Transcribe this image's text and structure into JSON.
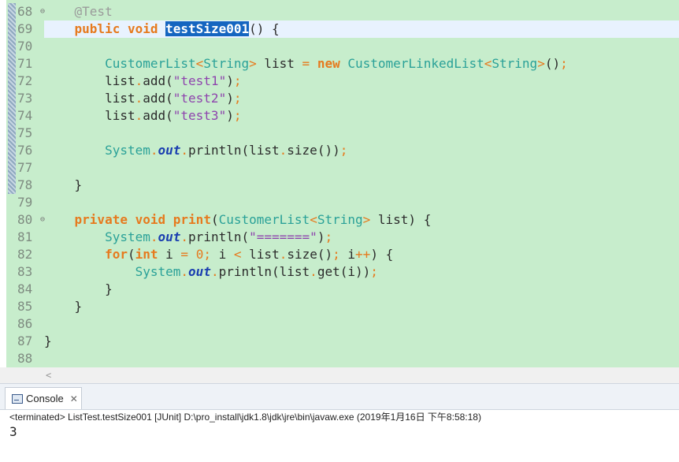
{
  "editor": {
    "colors": {
      "background": "#c7edcc",
      "current_line": "#e8f2fe",
      "selection": "#1565c0"
    },
    "lines": [
      {
        "num": "68",
        "fold": "⊖",
        "tokens": [
          [
            "ann",
            "    @Test"
          ]
        ]
      },
      {
        "num": "69",
        "tokens": [
          [
            "",
            "    "
          ],
          [
            "kw",
            "public"
          ],
          [
            "",
            " "
          ],
          [
            "kw",
            "void"
          ],
          [
            "",
            " "
          ],
          [
            "sel",
            "testSize001"
          ],
          [
            "",
            "() {"
          ]
        ]
      },
      {
        "num": "70",
        "tokens": []
      },
      {
        "num": "71",
        "tokens": [
          [
            "",
            "        "
          ],
          [
            "ty",
            "CustomerList"
          ],
          [
            "pu",
            "<"
          ],
          [
            "ty",
            "String"
          ],
          [
            "pu",
            ">"
          ],
          [
            "",
            " list "
          ],
          [
            "pu",
            "="
          ],
          [
            "",
            " "
          ],
          [
            "kw",
            "new"
          ],
          [
            "",
            " "
          ],
          [
            "ty",
            "CustomerLinkedList"
          ],
          [
            "pu",
            "<"
          ],
          [
            "ty",
            "String"
          ],
          [
            "pu",
            ">"
          ],
          [
            "",
            "()"
          ],
          [
            "pu",
            ";"
          ]
        ]
      },
      {
        "num": "72",
        "tokens": [
          [
            "",
            "        list"
          ],
          [
            "pu",
            "."
          ],
          [
            "",
            "add("
          ],
          [
            "str",
            "\"test1\""
          ],
          [
            "",
            ")"
          ],
          [
            "pu",
            ";"
          ]
        ]
      },
      {
        "num": "73",
        "tokens": [
          [
            "",
            "        list"
          ],
          [
            "pu",
            "."
          ],
          [
            "",
            "add("
          ],
          [
            "str",
            "\"test2\""
          ],
          [
            "",
            ")"
          ],
          [
            "pu",
            ";"
          ]
        ]
      },
      {
        "num": "74",
        "tokens": [
          [
            "",
            "        list"
          ],
          [
            "pu",
            "."
          ],
          [
            "",
            "add("
          ],
          [
            "str",
            "\"test3\""
          ],
          [
            "",
            ")"
          ],
          [
            "pu",
            ";"
          ]
        ]
      },
      {
        "num": "75",
        "tokens": []
      },
      {
        "num": "76",
        "tokens": [
          [
            "",
            "        "
          ],
          [
            "ty",
            "System"
          ],
          [
            "pu",
            "."
          ],
          [
            "st",
            "out"
          ],
          [
            "pu",
            "."
          ],
          [
            "",
            "println(list"
          ],
          [
            "pu",
            "."
          ],
          [
            "",
            "size())"
          ],
          [
            "pu",
            ";"
          ]
        ]
      },
      {
        "num": "77",
        "tokens": []
      },
      {
        "num": "78",
        "tokens": [
          [
            "",
            "    }"
          ]
        ]
      },
      {
        "num": "79",
        "tokens": []
      },
      {
        "num": "80",
        "fold": "⊖",
        "tokens": [
          [
            "",
            "    "
          ],
          [
            "kw",
            "private"
          ],
          [
            "",
            " "
          ],
          [
            "kw",
            "void"
          ],
          [
            "",
            " "
          ],
          [
            "kw",
            "print"
          ],
          [
            "",
            "("
          ],
          [
            "ty",
            "CustomerList"
          ],
          [
            "pu",
            "<"
          ],
          [
            "ty",
            "String"
          ],
          [
            "pu",
            ">"
          ],
          [
            "",
            " list) {"
          ]
        ]
      },
      {
        "num": "81",
        "tokens": [
          [
            "",
            "        "
          ],
          [
            "ty",
            "System"
          ],
          [
            "pu",
            "."
          ],
          [
            "st",
            "out"
          ],
          [
            "pu",
            "."
          ],
          [
            "",
            "println("
          ],
          [
            "str",
            "\"=======\""
          ],
          [
            "",
            ")"
          ],
          [
            "pu",
            ";"
          ]
        ]
      },
      {
        "num": "82",
        "tokens": [
          [
            "",
            "        "
          ],
          [
            "kw",
            "for"
          ],
          [
            "",
            "("
          ],
          [
            "kw",
            "int"
          ],
          [
            "",
            " i "
          ],
          [
            "pu",
            "="
          ],
          [
            "",
            " "
          ],
          [
            "num",
            "0"
          ],
          [
            "pu",
            ";"
          ],
          [
            "",
            " i "
          ],
          [
            "pu",
            "<"
          ],
          [
            "",
            " list"
          ],
          [
            "pu",
            "."
          ],
          [
            "",
            "size()"
          ],
          [
            "pu",
            ";"
          ],
          [
            "",
            " i"
          ],
          [
            "pu",
            "++"
          ],
          [
            "",
            ") {"
          ]
        ]
      },
      {
        "num": "83",
        "tokens": [
          [
            "",
            "            "
          ],
          [
            "ty",
            "System"
          ],
          [
            "pu",
            "."
          ],
          [
            "st",
            "out"
          ],
          [
            "pu",
            "."
          ],
          [
            "",
            "println(list"
          ],
          [
            "pu",
            "."
          ],
          [
            "",
            "get(i))"
          ],
          [
            "pu",
            ";"
          ]
        ]
      },
      {
        "num": "84",
        "tokens": [
          [
            "",
            "        }"
          ]
        ]
      },
      {
        "num": "85",
        "tokens": [
          [
            "",
            "    }"
          ]
        ]
      },
      {
        "num": "86",
        "tokens": []
      },
      {
        "num": "87",
        "tokens": [
          [
            "",
            "}"
          ]
        ]
      },
      {
        "num": "88",
        "tokens": []
      }
    ],
    "scroll_left_glyph": "<"
  },
  "console": {
    "tab_label": "Console",
    "close_glyph": "✕",
    "status": "<terminated> ListTest.testSize001 [JUnit] D:\\pro_install\\jdk1.8\\jdk\\jre\\bin\\javaw.exe (2019年1月16日 下午8:58:18)",
    "output": "3"
  }
}
